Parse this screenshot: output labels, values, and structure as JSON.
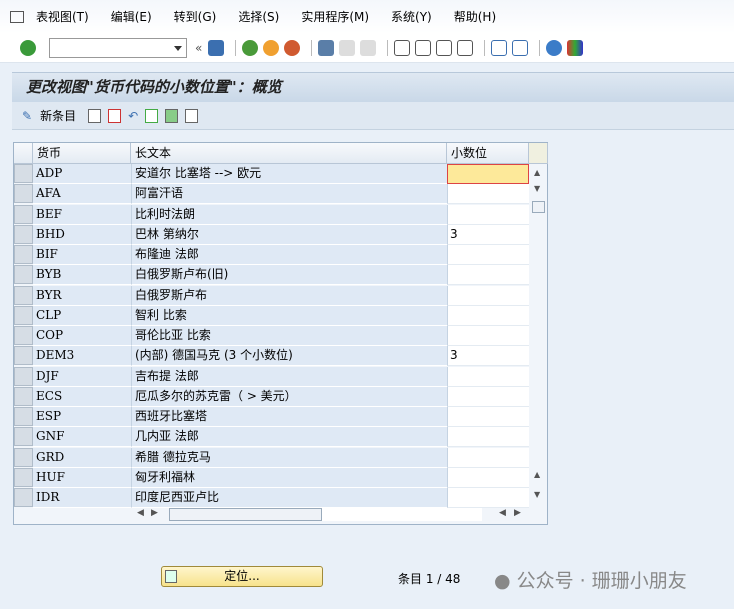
{
  "menu": [
    "表视图(T)",
    "编辑(E)",
    "转到(G)",
    "选择(S)",
    "实用程序(M)",
    "系统(Y)",
    "帮助(H)"
  ],
  "title": "更改视图\"货币代码的小数位置\"：概览",
  "app_toolbar": {
    "new_entries": "新条目"
  },
  "table": {
    "headers": [
      "货币",
      "长文本",
      "小数位"
    ],
    "rows": [
      [
        "ADP",
        "安道尔 比塞塔 --> 欧元",
        ""
      ],
      [
        "AFA",
        "阿富汗语",
        ""
      ],
      [
        "BEF",
        "比利时法朗",
        ""
      ],
      [
        "BHD",
        "巴林 第纳尔",
        "3"
      ],
      [
        "BIF",
        "布隆迪 法郎",
        ""
      ],
      [
        "BYB",
        "白俄罗斯卢布(旧)",
        ""
      ],
      [
        "BYR",
        "白俄罗斯卢布",
        ""
      ],
      [
        "CLP",
        "智利 比索",
        ""
      ],
      [
        "COP",
        "哥伦比亚 比索",
        ""
      ],
      [
        "DEM3",
        "(内部) 德国马克 (3 个小数位)",
        "3"
      ],
      [
        "DJF",
        "吉布提 法郎",
        ""
      ],
      [
        "ECS",
        "厄瓜多尔的苏克雷（ > 美元）",
        ""
      ],
      [
        "ESP",
        "西班牙比塞塔",
        ""
      ],
      [
        "GNF",
        "几内亚 法郎",
        ""
      ],
      [
        "GRD",
        "希腊 德拉克马",
        ""
      ],
      [
        "HUF",
        "匈牙利福林",
        ""
      ],
      [
        "IDR",
        "印度尼西亚卢比",
        ""
      ]
    ]
  },
  "footer": {
    "position_button": "定位...",
    "entry_count": "条目 1 / 48",
    "watermark": "公众号 · 珊珊小朋友"
  },
  "colors": {
    "accent": "#f7e38c",
    "focus": "#fde99a"
  }
}
